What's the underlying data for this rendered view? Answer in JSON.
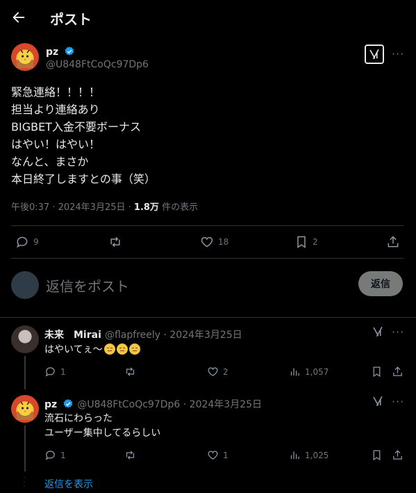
{
  "header": {
    "title": "ポスト"
  },
  "post": {
    "author_name": "pz",
    "author_handle": "@U848FtCoQc97Dp6",
    "lines": [
      "緊急連絡！！！！",
      "担当より連絡あり",
      "BIGBET入金不要ボーナス",
      "はやい！はやい！",
      "なんと、まさか",
      "本日終了しますとの事（笑）"
    ],
    "time": "午後0:37 · 2024年3月25日 ·",
    "views_count": "1.8万",
    "views_label": "件の表示",
    "stats": {
      "replies": "9",
      "reposts": "",
      "likes": "18",
      "bookmarks": "2"
    }
  },
  "reply_box": {
    "placeholder": "返信をポスト",
    "button_label": "返信"
  },
  "replies": [
    {
      "name": "未来　Mirai",
      "handle_date": "@flapfreely · 2024年3月25日",
      "text": "はやいてぇ〜",
      "emoji_count": 3,
      "stats": {
        "replies": "1",
        "likes": "2",
        "views": "1,057"
      }
    },
    {
      "name": "pz",
      "handle_date": "@U848FtCoQc97Dp6 · 2024年3月25日",
      "lines": [
        "流石にわらった",
        "ユーザー集中してるらしい"
      ],
      "stats": {
        "replies": "1",
        "likes": "1",
        "views": "1,025"
      }
    }
  ],
  "show_replies": "返信を表示",
  "colors": {
    "background": "#000000",
    "text": "#e7e9ea",
    "muted": "#71767b",
    "link": "#1d9bf0",
    "verified": "#1d9bf0"
  }
}
